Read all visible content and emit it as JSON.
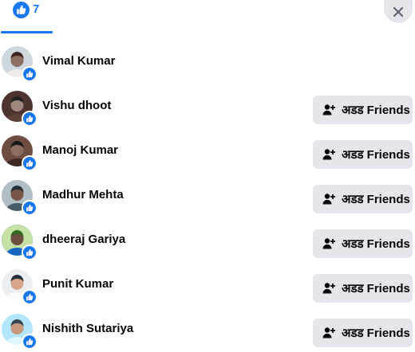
{
  "header": {
    "tab_all_count": "7",
    "close_label": "Close"
  },
  "people": [
    {
      "name": "Vimal Kumar",
      "show_add": false
    },
    {
      "name": "Vishu dhoot",
      "show_add": true
    },
    {
      "name": "Manoj Kumar",
      "show_add": true
    },
    {
      "name": "Madhur Mehta",
      "show_add": true
    },
    {
      "name": "dheeraj Gariya",
      "show_add": true
    },
    {
      "name": "Punit Kumar",
      "show_add": true
    },
    {
      "name": "Nishith Sutariya",
      "show_add": true
    }
  ],
  "add_friend_label": "अडड Friends",
  "colors": {
    "accent": "#1877f2",
    "button_bg": "#e4e6eb",
    "text": "#050505"
  },
  "icons": {
    "reaction": "like-icon",
    "reaction_badge": "like-badge-icon",
    "add_friend": "add-friend-icon",
    "close": "close-icon"
  }
}
